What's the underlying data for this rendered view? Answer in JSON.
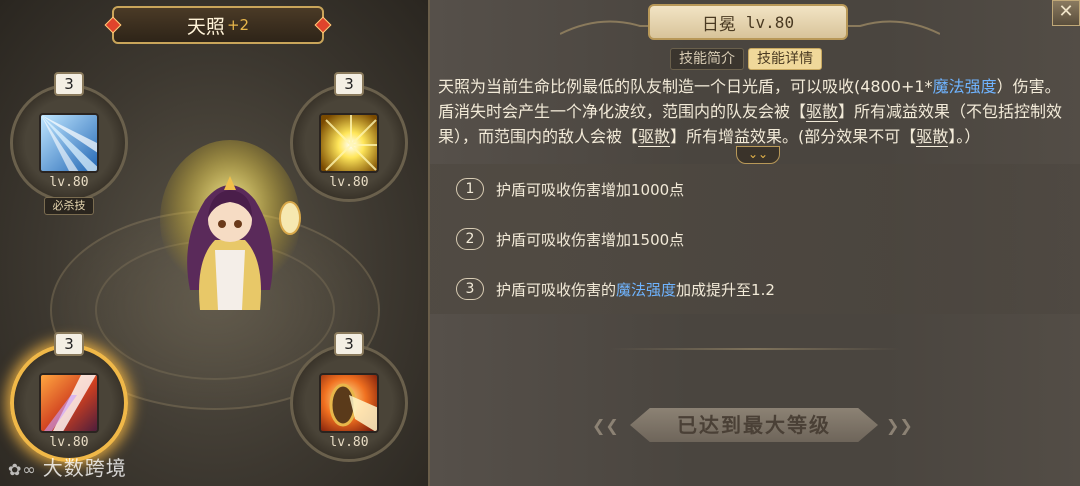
{
  "hero": {
    "name": "天照",
    "plus": "+2"
  },
  "skills": [
    {
      "level_badge": "3",
      "lv": "lv.80",
      "tag": "必杀技",
      "icon": "light-rays-icon"
    },
    {
      "level_badge": "3",
      "lv": "lv.80",
      "icon": "sun-burst-icon"
    },
    {
      "level_badge": "3",
      "lv": "lv.80",
      "icon": "flame-beam-icon"
    },
    {
      "level_badge": "3",
      "lv": "lv.80",
      "icon": "fire-shield-icon"
    }
  ],
  "watermark": "大数跨境",
  "detail": {
    "skill_name": "日冕",
    "skill_level": "lv.80",
    "tabs": [
      "技能简介",
      "技能详情"
    ],
    "active_tab": "技能详情",
    "description": {
      "p1": "天照为当前生命比例最低的队友制造一个日光盾，可以吸收(4800+1*",
      "p1_hl": "魔法强度",
      "p1_end": "）伤害",
      "p2": "。盾消失时会产生一个净化波纹，范围内的队友会被【",
      "p2_ul": "驱散",
      "p2_end": "】所有减益效果（不包括",
      "p3": "控制效果），而范围内的敌人会被【",
      "p3_ul": "驱散",
      "p3_mid": "】所有增益效果。(部分效果不可【",
      "p3_ul2": "驱散",
      "p3_end": "】。",
      "p4": "）"
    },
    "upgrades": [
      {
        "num": "1",
        "text": "护盾可吸收伤害增加1000点"
      },
      {
        "num": "2",
        "text": "护盾可吸收伤害增加1500点"
      },
      {
        "num": "3",
        "text_pre": "护盾可吸收伤害的",
        "text_hl": "魔法强度",
        "text_post": "加成提升至1.2"
      }
    ],
    "max_label": "已达到最大等级"
  },
  "colors": {
    "highlight": "#6fb4ff",
    "gold": "#e8b64a",
    "active_glow": "#f0b848"
  }
}
